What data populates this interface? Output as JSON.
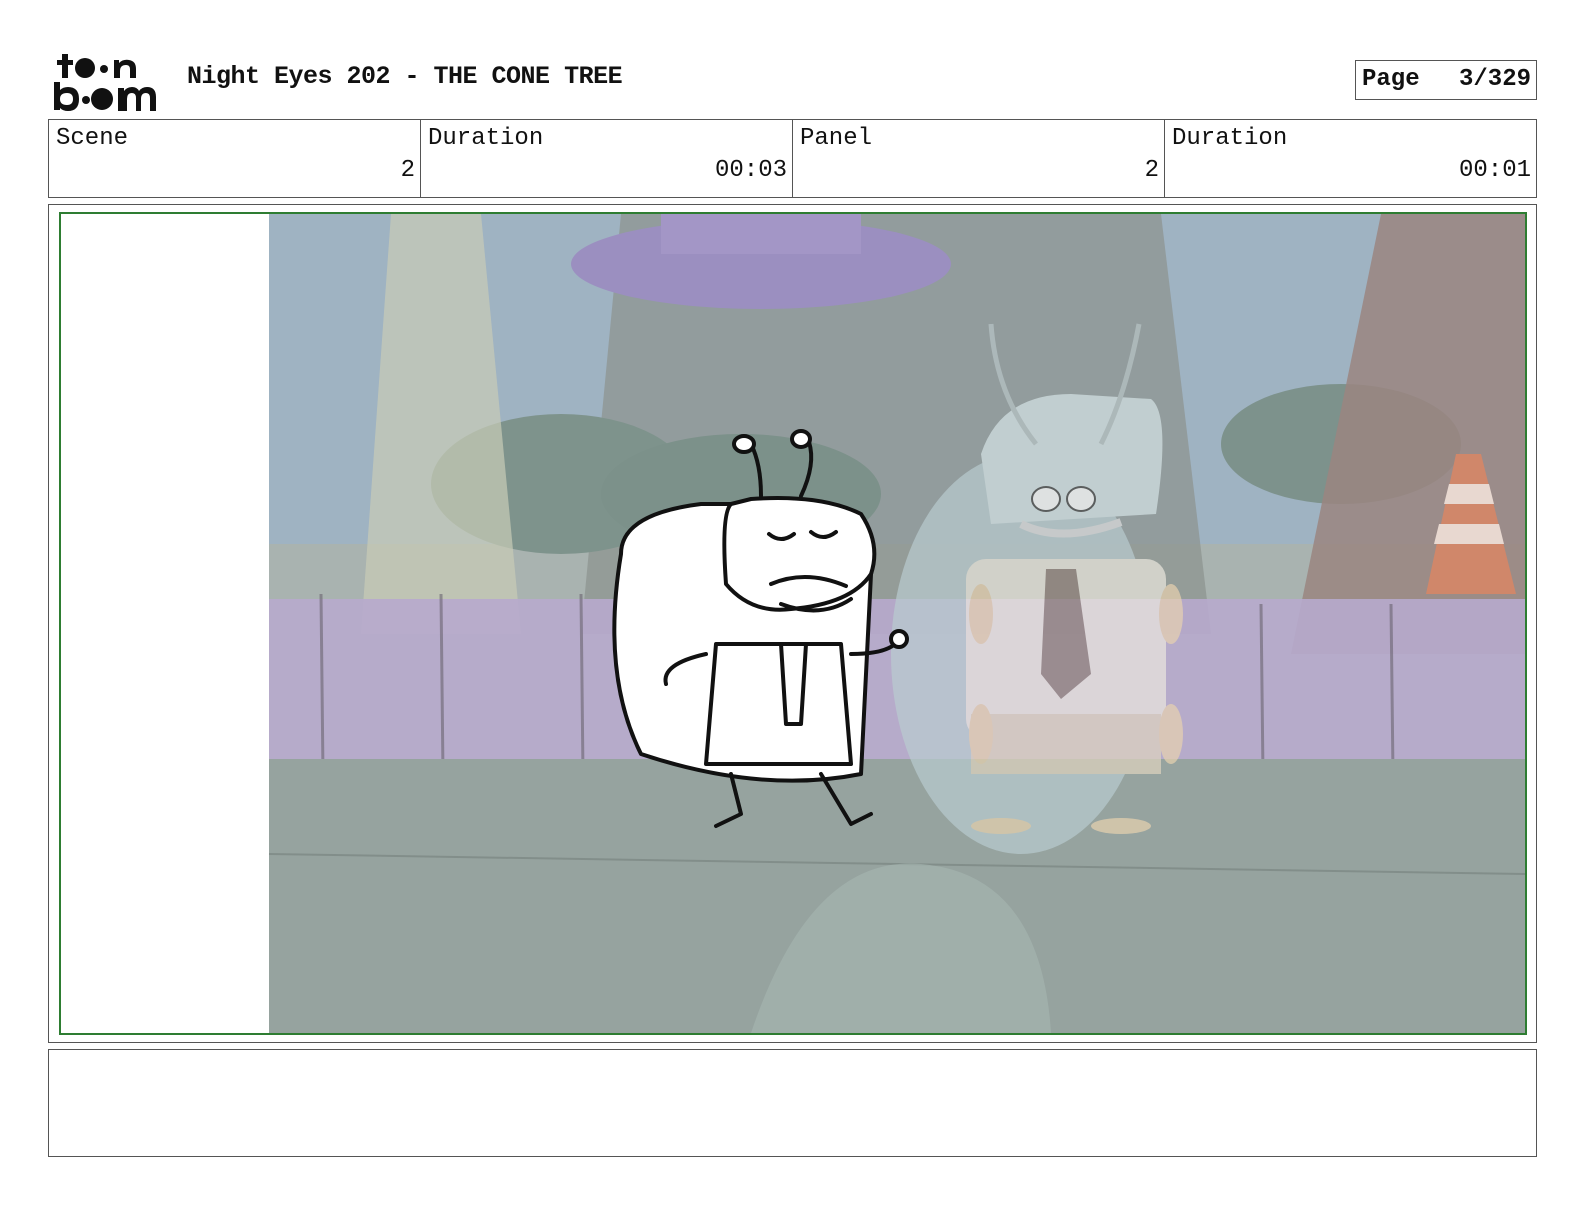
{
  "header": {
    "logo_text": "toon boom",
    "title": "Night Eyes 202 - THE CONE TREE",
    "page_label": "Page",
    "page_number": "3/329"
  },
  "info": {
    "scene_label": "Scene",
    "scene_value": "2",
    "scene_duration_label": "Duration",
    "scene_duration_value": "00:03",
    "panel_label": "Panel",
    "panel_value": "2",
    "panel_duration_label": "Duration",
    "panel_duration_value": "00:01"
  },
  "notes": {
    "text": ""
  }
}
